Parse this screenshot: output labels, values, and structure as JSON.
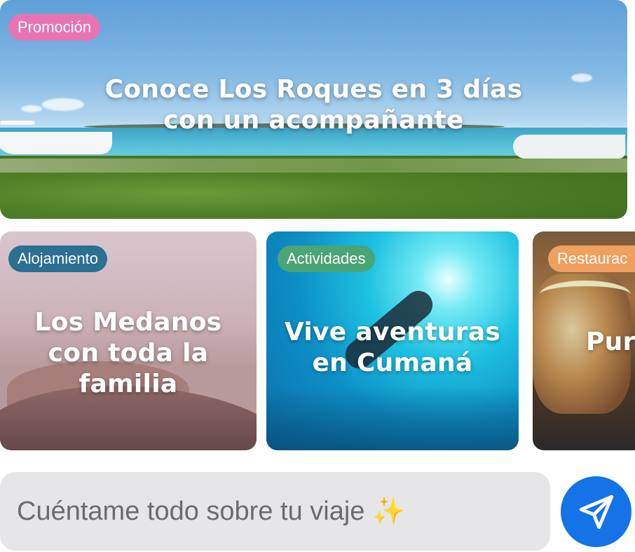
{
  "hero": {
    "badge": "Promoción",
    "title_line1": "Conoce Los Roques en 3 días",
    "title_line2": "con un acompañante"
  },
  "cards": [
    {
      "badge": "Alojamiento",
      "title_line1": "Los Medanos",
      "title_line2": "con toda la",
      "title_line3": "familia"
    },
    {
      "badge": "Actividades",
      "title_line1": "Vive aventuras",
      "title_line2": "en Cumaná"
    },
    {
      "badge": "Restaurac",
      "title_line1": "Pur"
    }
  ],
  "chat": {
    "placeholder": "Cuéntame todo sobre tu viaje ✨"
  },
  "send_icon": "paper-plane-icon",
  "colors": {
    "promocion_badge": "#e874b3",
    "alojamiento_badge": "#2b6f93",
    "actividades_badge": "#4aa476",
    "restaurantes_badge": "#f0a05e",
    "send_button": "#1473e6",
    "input_bg": "#e6e6e8"
  }
}
